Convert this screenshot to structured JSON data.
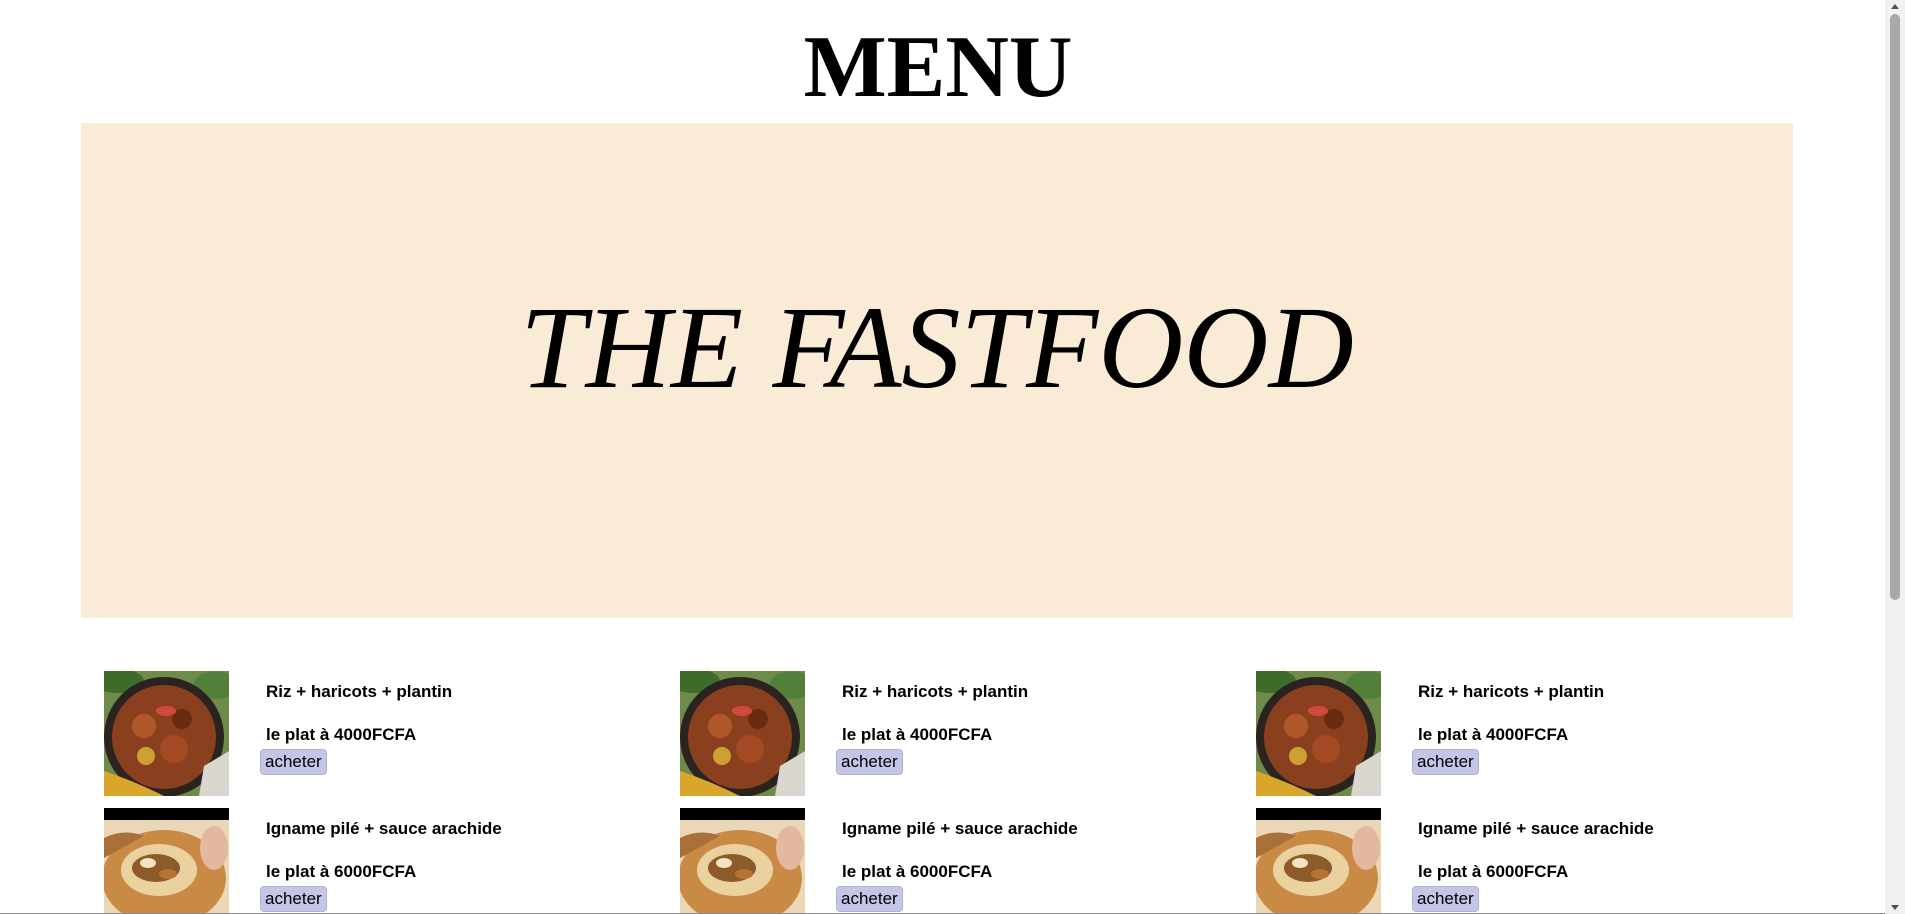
{
  "page": {
    "title": "MENU",
    "banner_text": "THE FASTFOOD"
  },
  "colors": {
    "banner_bg": "#faebd7",
    "button_bg": "#c5c5e8"
  },
  "menu": {
    "rows": [
      {
        "items": [
          {
            "name": "Riz + haricots + plantin",
            "price": "le plat à 4000FCFA",
            "button": "acheter",
            "image_icon": "rice-dish-icon"
          },
          {
            "name": "Riz + haricots + plantin",
            "price": "le plat à 4000FCFA",
            "button": "acheter",
            "image_icon": "rice-dish-icon"
          },
          {
            "name": "Riz + haricots + plantin",
            "price": "le plat à 4000FCFA",
            "button": "acheter",
            "image_icon": "rice-dish-icon"
          }
        ]
      },
      {
        "items": [
          {
            "name": "Igname pilé + sauce arachide",
            "price": "le plat à 6000FCFA",
            "button": "acheter",
            "image_icon": "wrap-dish-icon"
          },
          {
            "name": "Igname pilé + sauce arachide",
            "price": "le plat à 6000FCFA",
            "button": "acheter",
            "image_icon": "wrap-dish-icon"
          },
          {
            "name": "Igname pilé + sauce arachide",
            "price": "le plat à 6000FCFA",
            "button": "acheter",
            "image_icon": "wrap-dish-icon"
          }
        ]
      }
    ]
  }
}
